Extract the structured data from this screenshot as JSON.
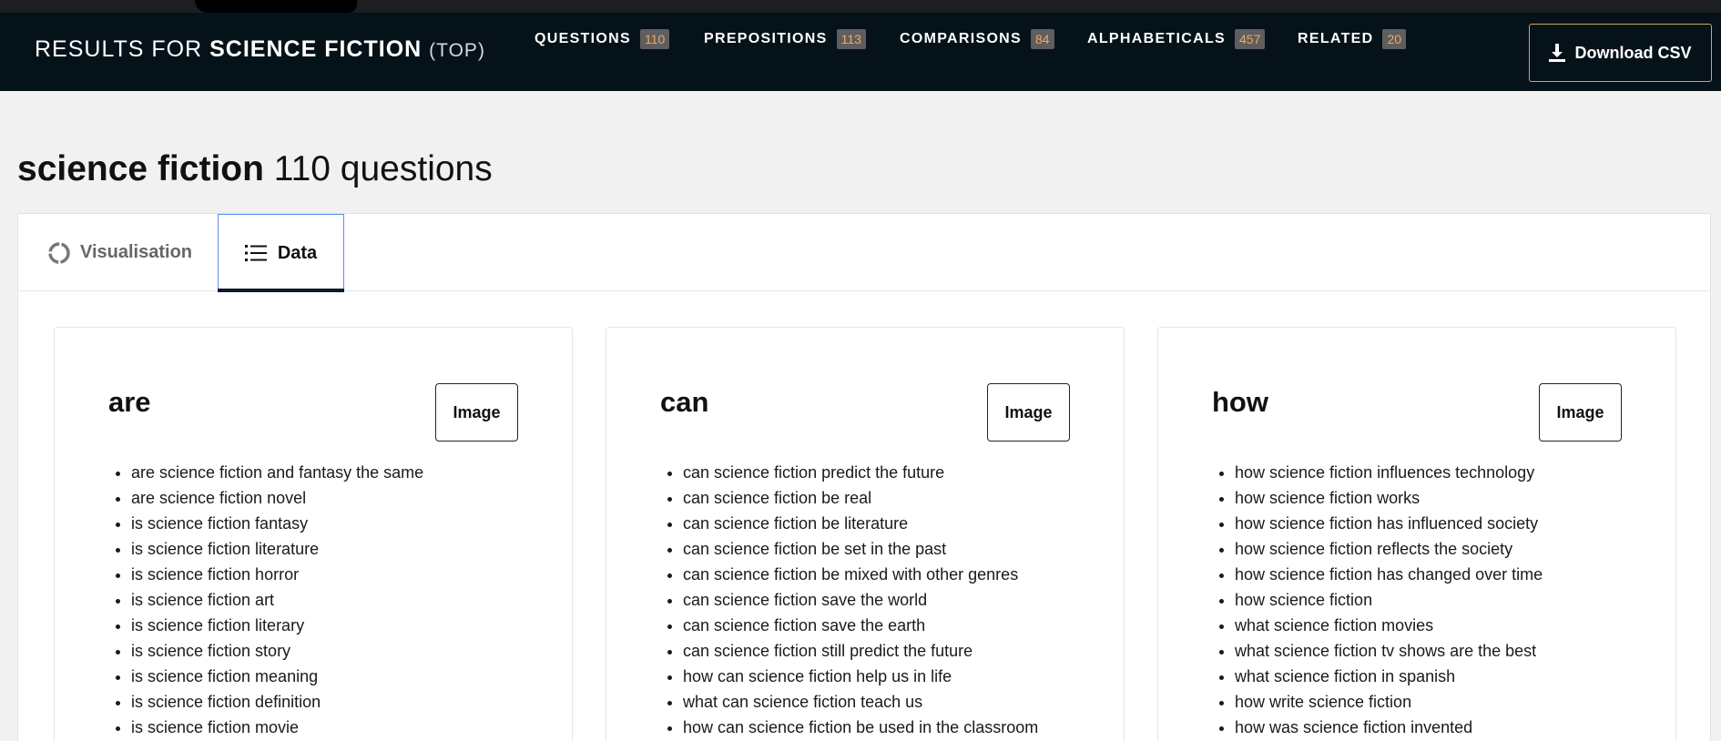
{
  "header": {
    "results_prefix": "RESULTS FOR",
    "keyword": "SCIENCE FICTION",
    "mode": "(TOP)",
    "tabs": [
      {
        "label": "QUESTIONS",
        "count": "110"
      },
      {
        "label": "PREPOSITIONS",
        "count": "113"
      },
      {
        "label": "COMPARISONS",
        "count": "84"
      },
      {
        "label": "ALPHABETICALS",
        "count": "457"
      },
      {
        "label": "RELATED",
        "count": "20"
      }
    ],
    "download_label": "Download CSV"
  },
  "heading": {
    "keyword": "science fiction",
    "count_text": "110 questions"
  },
  "view_tabs": {
    "visualisation": "Visualisation",
    "data": "Data"
  },
  "cards": [
    {
      "title": "are",
      "image_label": "Image",
      "items": [
        "are science fiction and fantasy the same",
        "are science fiction novel",
        "is science fiction fantasy",
        "is science fiction literature",
        "is science fiction horror",
        "is science fiction art",
        "is science fiction literary",
        "is science fiction story",
        "is science fiction meaning",
        "is science fiction definition",
        "is science fiction movie"
      ]
    },
    {
      "title": "can",
      "image_label": "Image",
      "items": [
        "can science fiction predict the future",
        "can science fiction be real",
        "can science fiction be literature",
        "can science fiction be set in the past",
        "can science fiction be mixed with other genres",
        "can science fiction save the world",
        "can science fiction save the earth",
        "can science fiction still predict the future",
        "how can science fiction help us in life",
        "what can science fiction teach us",
        "how can science fiction be used in the classroom"
      ]
    },
    {
      "title": "how",
      "image_label": "Image",
      "items": [
        "how science fiction influences technology",
        "how science fiction works",
        "how science fiction has influenced society",
        "how science fiction reflects the society",
        "how science fiction has changed over time",
        "how science fiction",
        "what science fiction movies",
        "what science fiction tv shows are the best",
        "what science fiction in spanish",
        "how write science fiction",
        "how was science fiction invented"
      ]
    }
  ]
}
